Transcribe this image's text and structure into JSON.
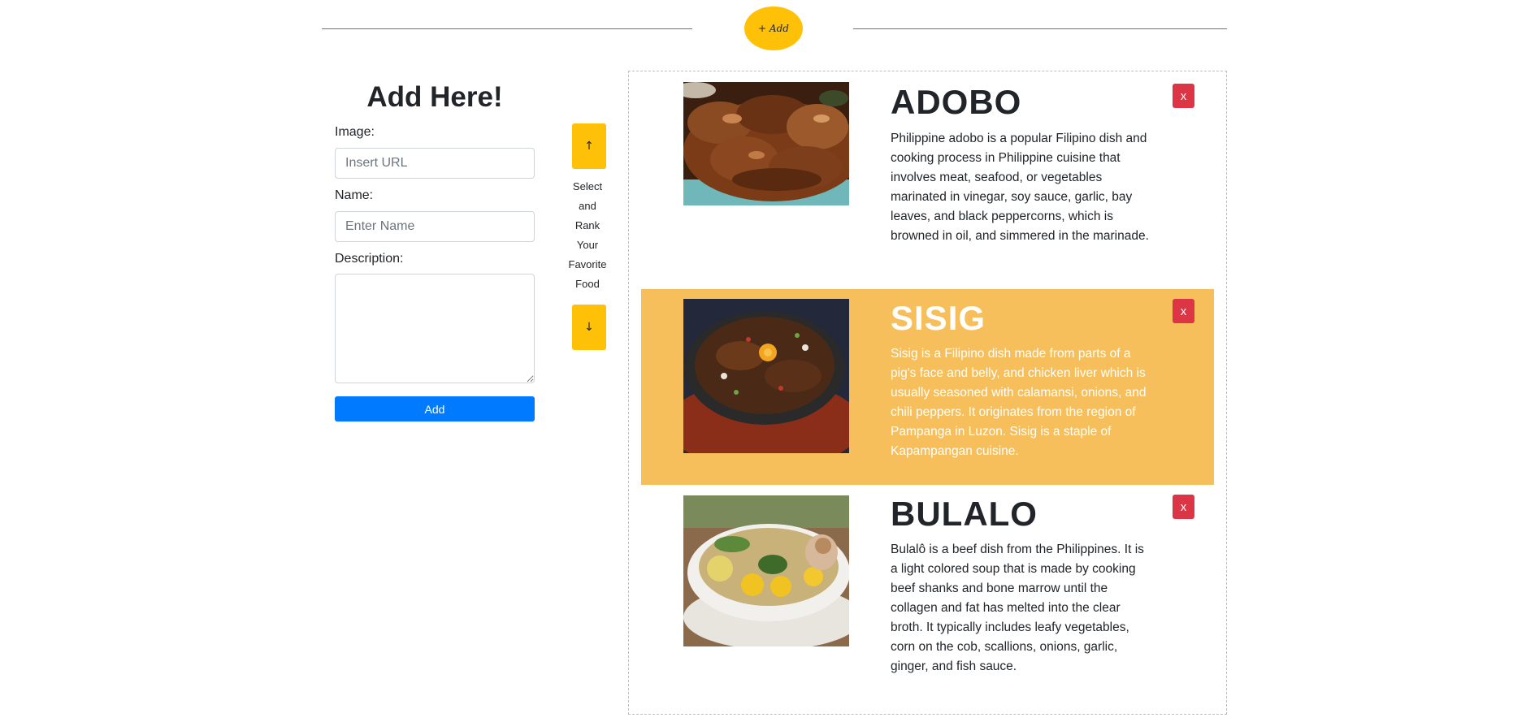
{
  "header": {
    "add_label": "+ Add"
  },
  "form": {
    "title": "Add Here!",
    "image_label": "Image:",
    "image_placeholder": "Insert URL",
    "name_label": "Name:",
    "name_placeholder": "Enter Name",
    "description_label": "Description:",
    "description_value": "",
    "submit_label": "Add"
  },
  "rank": {
    "up_label": "↑",
    "down_label": "↓",
    "words": [
      "Select",
      "and",
      "Rank",
      "Your",
      "Favorite",
      "Food"
    ]
  },
  "foods": [
    {
      "name": "ADOBO",
      "description": "Philippine adobo is a popular Filipino dish and cooking process in Philippine cuisine that involves meat, seafood, or vegetables marinated in vinegar, soy sauce, garlic, bay leaves, and black peppercorns, which is browned in oil, and simmered in the marinade.",
      "remove_label": "x",
      "selected": false
    },
    {
      "name": "SISIG",
      "description": "Sisig is a Filipino dish made from parts of a pig's face and belly, and chicken liver which is usually seasoned with calamansi, onions, and chili peppers. It originates from the region of Pampanga in Luzon. Sisig is a staple of Kapampangan cuisine.",
      "remove_label": "x",
      "selected": true
    },
    {
      "name": "BULALO",
      "description": "Bulalô is a beef dish from the Philippines. It is a light colored soup that is made by cooking beef shanks and bone marrow until the collagen and fat has melted into the clear broth. It typically includes leafy vegetables, corn on the cob, scallions, onions, garlic, ginger, and fish sauce.",
      "remove_label": "x",
      "selected": false
    }
  ],
  "colors": {
    "accent": "#ffc107",
    "selected_bg": "#f6bf5b",
    "primary": "#007bff",
    "danger": "#dc3545"
  }
}
